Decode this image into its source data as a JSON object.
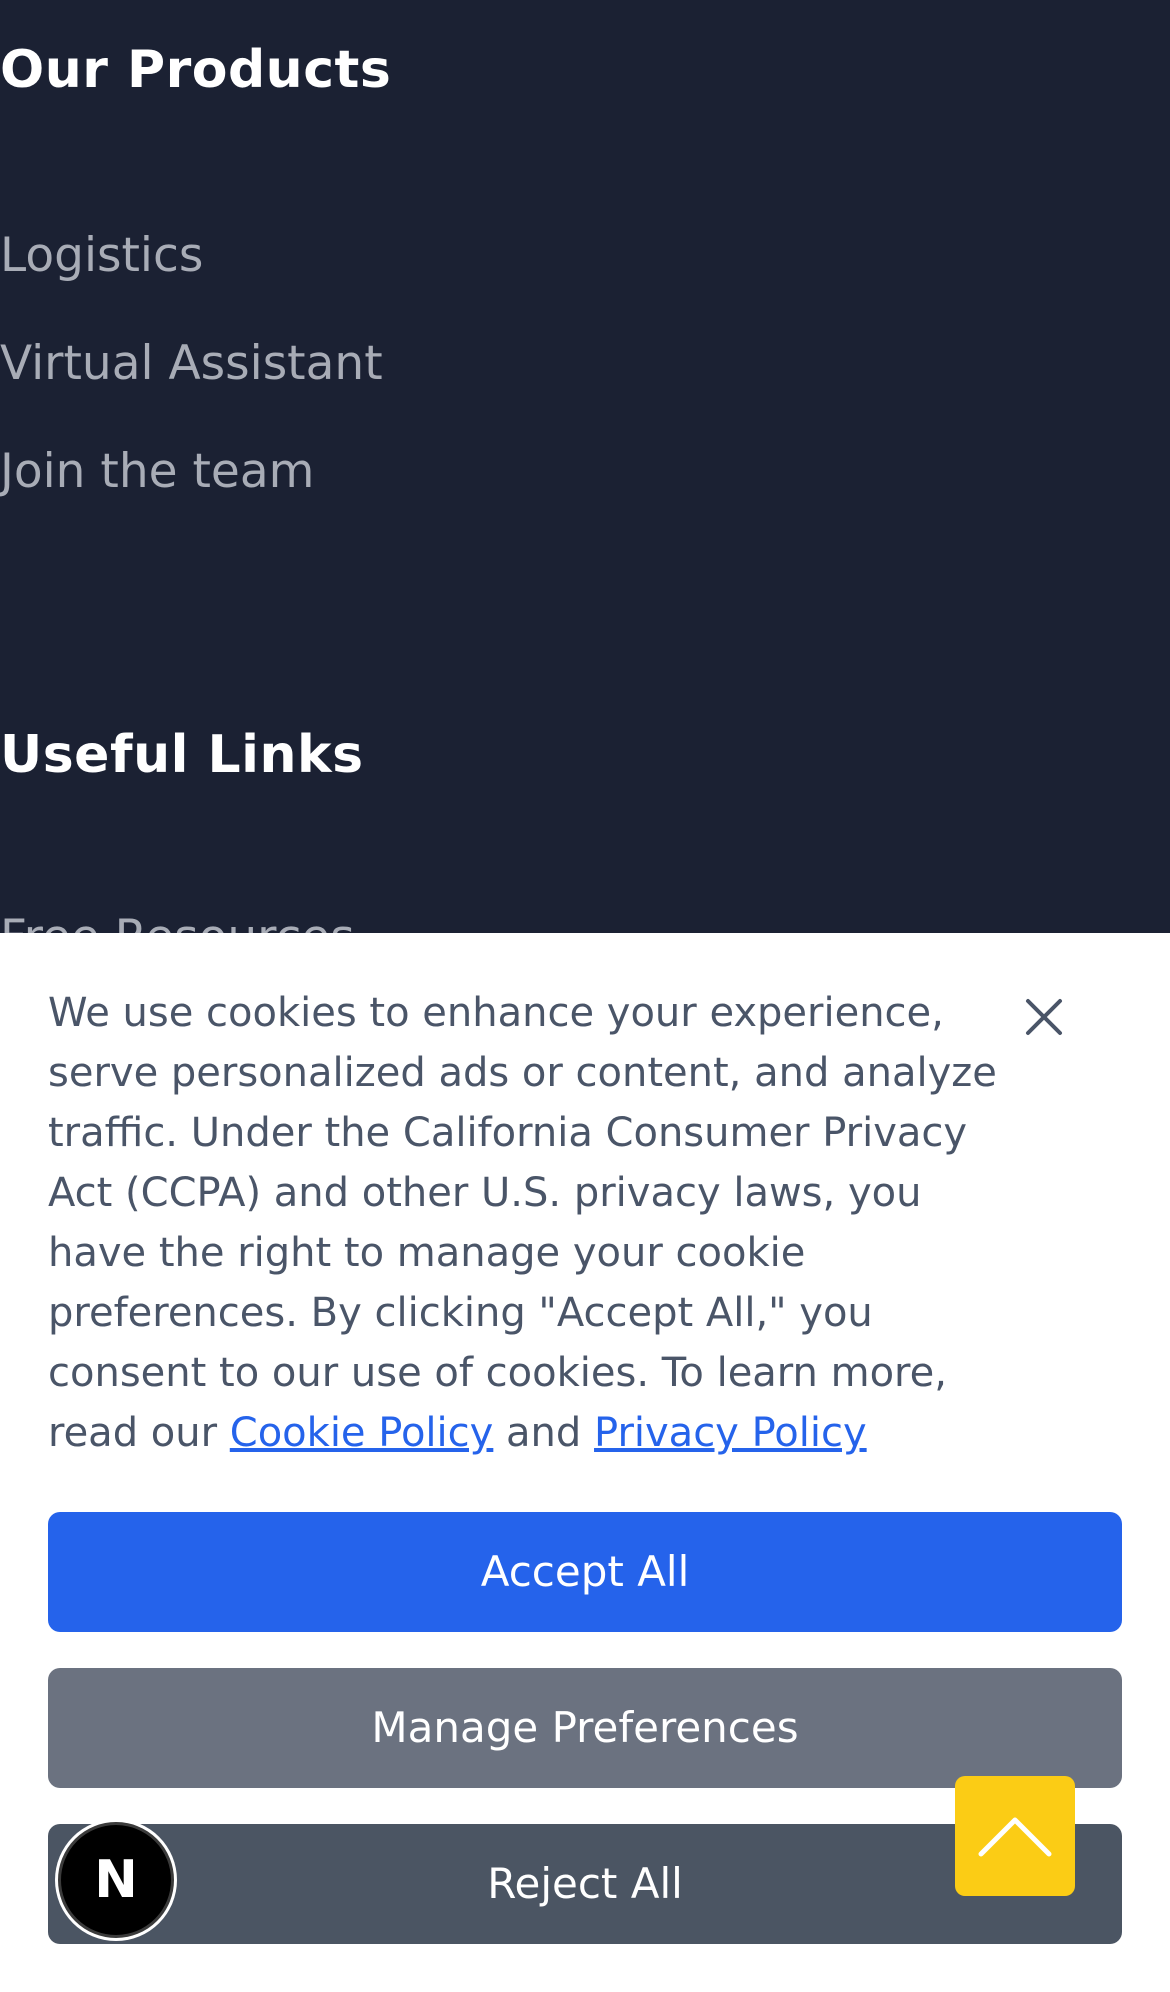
{
  "footer": {
    "products_heading": "Our Products",
    "product_links": [
      "Logistics",
      "Virtual Assistant",
      "Join the team"
    ],
    "useful_heading": "Useful Links",
    "useful_links": [
      "Free Resources"
    ]
  },
  "cookie_banner": {
    "message": "We use cookies to enhance your experience, serve personalized ads or content, and analyze traffic. Under the California Consumer Privacy Act (CCPA) and other U.S. privacy laws, you have the right to manage your cookie preferences. By clicking \"Accept All,\" you consent to our use of cookies. To learn more, read our",
    "cookie_policy_link": "Cookie Policy",
    "connector": "and",
    "privacy_policy_link": "Privacy Policy",
    "accept_label": "Accept All",
    "manage_label": "Manage Preferences",
    "reject_label": "Reject All",
    "close_icon": "close-icon"
  },
  "floating": {
    "scroll_top_icon": "chevron-up-icon",
    "badge_letter": "N"
  },
  "colors": {
    "footer_bg": "#1b2133",
    "accent_blue": "#2563eb",
    "manage_gray": "#6b7280",
    "reject_slate": "#4b5563",
    "scroll_yellow": "#fbcc15"
  }
}
